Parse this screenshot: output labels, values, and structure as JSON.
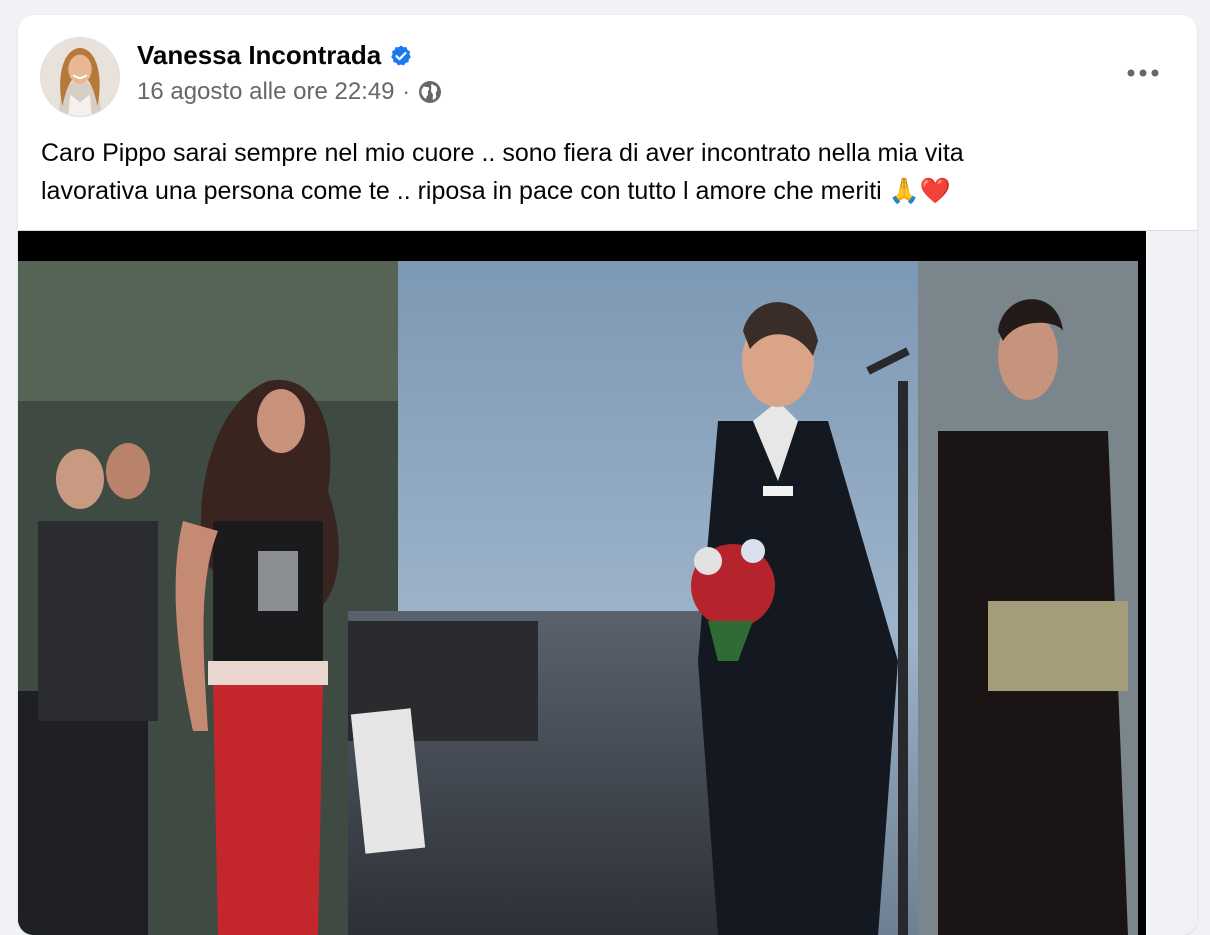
{
  "post": {
    "author": "Vanessa Incontrada",
    "verified": true,
    "timestamp": "16 agosto alle ore 22:49",
    "separator": "·",
    "audience_icon": "globe-icon",
    "more_icon": "more-options-icon",
    "text_lines": [
      "Caro Pippo sarai sempre nel mio cuore .. sono fiera di aver incontrato nella mia vita",
      "lavorativa una persona come te .. riposa in pace con tutto l amore che meriti "
    ],
    "emojis": [
      "🙏",
      "❤️"
    ],
    "media_type": "video"
  },
  "colors": {
    "background": "#f0f2f5",
    "card": "#ffffff",
    "primary_text": "#050505",
    "secondary_text": "#65676b",
    "verified_badge": "#1877f2"
  }
}
